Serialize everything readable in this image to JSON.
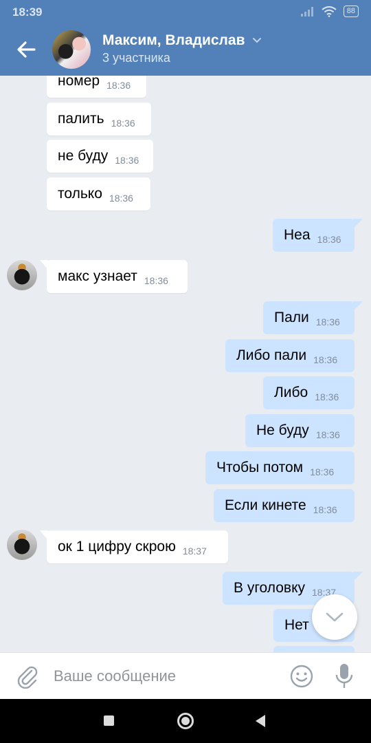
{
  "status_bar": {
    "time": "18:39",
    "battery": "88"
  },
  "header": {
    "title": "Максим, Владислав",
    "subtitle": "3 участника"
  },
  "messages": [
    {
      "direction": "in",
      "text": "номер",
      "time": "18:36"
    },
    {
      "direction": "in",
      "text": "палить",
      "time": "18:36"
    },
    {
      "direction": "in",
      "text": "не буду",
      "time": "18:36"
    },
    {
      "direction": "in",
      "text": "только",
      "time": "18:36"
    },
    {
      "direction": "out",
      "text": "Неа",
      "time": "18:36"
    },
    {
      "direction": "in",
      "text": "макс узнает",
      "time": "18:36"
    },
    {
      "direction": "out",
      "text": "Пали",
      "time": "18:36"
    },
    {
      "direction": "out",
      "text": "Либо пали",
      "time": "18:36"
    },
    {
      "direction": "out",
      "text": "Либо",
      "time": "18:36"
    },
    {
      "direction": "out",
      "text": "Не буду",
      "time": "18:36"
    },
    {
      "direction": "out",
      "text": "Чтобы потом",
      "time": "18:36"
    },
    {
      "direction": "out",
      "text": "Если кинете",
      "time": "18:36"
    },
    {
      "direction": "in",
      "text": "ок 1 цифру скрою",
      "time": "18:37"
    },
    {
      "direction": "out",
      "text": "В уголовку",
      "time": "18:37"
    },
    {
      "direction": "out",
      "text": "Нет",
      "time": ""
    }
  ],
  "composer": {
    "placeholder": "Ваше сообщение"
  },
  "icons": {
    "back": "back-arrow-icon",
    "dropdown": "chevron-down-icon",
    "attach": "paperclip-icon",
    "emoji": "smiley-icon",
    "mic": "microphone-icon",
    "scroll": "scroll-down-icon"
  },
  "colors": {
    "header": "#5181b8",
    "incoming_bubble": "#ffffff",
    "outgoing_bubble": "#cce4ff",
    "background": "#e9edf1"
  }
}
